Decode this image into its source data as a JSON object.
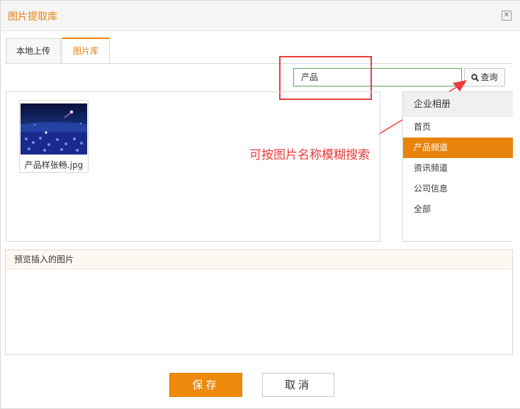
{
  "dialog": {
    "title": "图片提取库"
  },
  "tabs": [
    {
      "label": "本地上传",
      "active": false
    },
    {
      "label": "图片库",
      "active": true
    }
  ],
  "search": {
    "value": "产品",
    "button_label": "查询"
  },
  "annotation": {
    "text": "可按图片名称模糊搜索"
  },
  "images": [
    {
      "caption": "产品样张畅.jpg"
    }
  ],
  "albums": {
    "header": "企业相册",
    "items": [
      {
        "label": "首页"
      },
      {
        "label": "产品频道",
        "active": true
      },
      {
        "label": "资讯频道"
      },
      {
        "label": "公司信息"
      },
      {
        "label": "全部"
      }
    ]
  },
  "preview": {
    "label": "预览插入的图片"
  },
  "footer": {
    "save_label": "保存",
    "cancel_label": "取消"
  },
  "colors": {
    "accent": "#e8830c",
    "annotation": "#e83c3c",
    "input_border": "#5aa55a"
  }
}
